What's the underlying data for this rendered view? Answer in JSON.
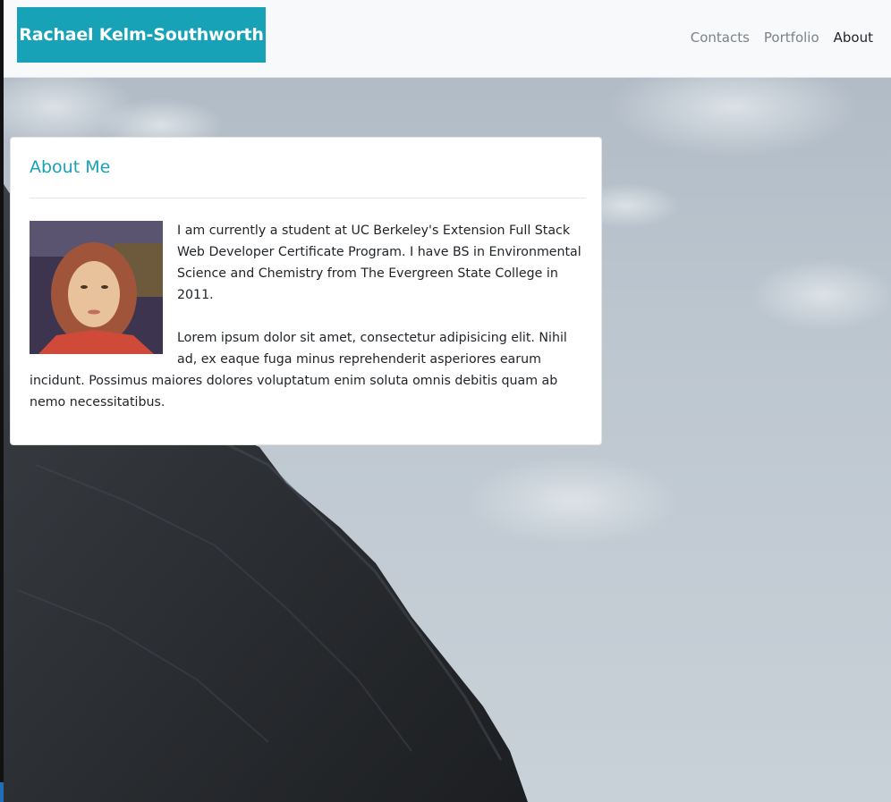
{
  "navbar": {
    "brand": "Rachael Kelm-Southworth",
    "links": [
      {
        "label": "Contacts",
        "active": false
      },
      {
        "label": "Portfolio",
        "active": false
      },
      {
        "label": "About",
        "active": true
      }
    ]
  },
  "about": {
    "title": "About Me",
    "paragraphs": [
      "I am currently a student at UC Berkeley's Extension Full Stack Web Developer Certificate Program. I have BS in Environmental Science and Chemistry from The Evergreen State College in 2011.",
      "Lorem ipsum dolor sit amet, consectetur adipisicing elit. Nihil ad, ex eaque fuga minus reprehenderit asperiores earum incidunt. Possimus maiores dolores voluptatum enim soluta omnis debitis quam ab nemo necessitatibus."
    ]
  },
  "colors": {
    "accent": "#17a2b8",
    "navbar_bg": "#f8f9fa",
    "nav_link": "#7c8288",
    "nav_link_active": "#212529"
  }
}
